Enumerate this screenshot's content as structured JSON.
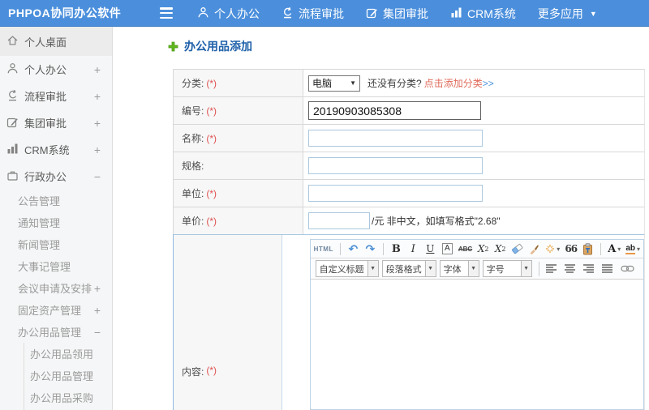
{
  "colors": {
    "header_bg": "#4b8fdc",
    "accent_green": "#5fb71e",
    "title_blue": "#1d5fa9",
    "required_red": "#e05151",
    "link_red": "#e06a5a",
    "link_blue": "#4a90d9"
  },
  "header": {
    "logo": "PHPOA协同办公软件",
    "nav": [
      {
        "label": "个人办公",
        "icon": "user-icon"
      },
      {
        "label": "流程审批",
        "icon": "flow-icon"
      },
      {
        "label": "集团审批",
        "icon": "edit-icon"
      },
      {
        "label": "CRM系统",
        "icon": "chart-icon"
      },
      {
        "label": "更多应用",
        "icon": "caret-down-icon"
      }
    ]
  },
  "sidebar": {
    "items": [
      {
        "label": "个人桌面",
        "icon": "home-icon",
        "expander": "",
        "level": 0,
        "active": true
      },
      {
        "label": "个人办公",
        "icon": "user-icon",
        "expander": "+",
        "level": 0
      },
      {
        "label": "流程审批",
        "icon": "flow-icon",
        "expander": "+",
        "level": 0
      },
      {
        "label": "集团审批",
        "icon": "edit-icon",
        "expander": "+",
        "level": 0
      },
      {
        "label": "CRM系统",
        "icon": "chart-icon",
        "expander": "+",
        "level": 0
      },
      {
        "label": "行政办公",
        "icon": "briefcase-icon",
        "expander": "−",
        "level": 0
      },
      {
        "label": "公告管理",
        "level": 1
      },
      {
        "label": "通知管理",
        "level": 1
      },
      {
        "label": "新闻管理",
        "level": 1
      },
      {
        "label": "大事记管理",
        "level": 1
      },
      {
        "label": "会议申请及安排",
        "expander": "+",
        "level": 1
      },
      {
        "label": "固定资产管理",
        "expander": "+",
        "level": 1
      },
      {
        "label": "办公用品管理",
        "expander": "−",
        "level": 1
      },
      {
        "label": "办公用品领用",
        "level": 2
      },
      {
        "label": "办公用品管理",
        "level": 2
      },
      {
        "label": "办公用品采购",
        "level": 2
      }
    ]
  },
  "main": {
    "title": "办公用品添加",
    "form": {
      "category": {
        "label": "分类:",
        "required": "(*)",
        "select_value": "电脑",
        "hint": "还没有分类?",
        "link": "点击添加分类",
        "link_arrows": ">>"
      },
      "code": {
        "label": "编号:",
        "required": "(*)",
        "value": "20190903085308"
      },
      "name": {
        "label": "名称:",
        "required": "(*)",
        "value": ""
      },
      "spec": {
        "label": "规格:",
        "required": "",
        "value": ""
      },
      "unit": {
        "label": "单位:",
        "required": "(*)",
        "value": ""
      },
      "price": {
        "label": "单价:",
        "required": "(*)",
        "value": "",
        "hint": "/元 非中文，如填写格式\"2.68\""
      },
      "content": {
        "label": "内容:",
        "required": "(*)"
      }
    },
    "editor": {
      "html_label": "HTML",
      "undo": "↶",
      "redo": "↷",
      "bold": "B",
      "italic": "I",
      "underline": "U",
      "char_border": "A",
      "strike": "ABC",
      "sup_x": "X",
      "sup_n": "2",
      "sub_x": "X",
      "sub_n": "2",
      "quote": "66",
      "font_color": "A",
      "highlight": "ab",
      "selects": [
        {
          "label": "自定义标题"
        },
        {
          "label": "段落格式"
        },
        {
          "label": "字体"
        },
        {
          "label": "字号"
        }
      ]
    }
  }
}
